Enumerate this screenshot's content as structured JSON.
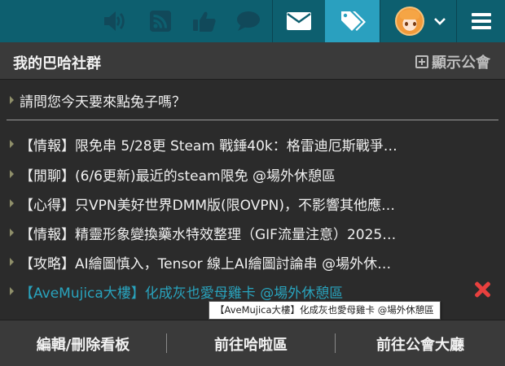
{
  "navbar": {
    "icons": [
      "volume-icon",
      "rss-icon",
      "thumbs-up-icon",
      "chat-bubble-icon",
      "envelope-icon",
      "tags-icon",
      "avatar",
      "chevron-down-icon",
      "menu-icon"
    ],
    "active_color": "#2aa0bf",
    "bar_color": "#0d5f6f"
  },
  "panel": {
    "title": "我的巴哈社群",
    "show_guild_label": "顯示公會",
    "prompt": "請問您今天要來點兔子嗎？",
    "items": [
      {
        "label": "【情報】限免串 5/28更 Steam 戰錘40k：格雷迪厄斯戰爭…"
      },
      {
        "label": "【閒聊】(6/6更新)最近的steam限免 @場外休憩區"
      },
      {
        "label": "【心得】只VPN美好世界DMM版(限OVPN)，不影響其他應…"
      },
      {
        "label": "【情報】精靈形象變換藥水特效整理（GIF流量注意）2025…"
      },
      {
        "label": "【攻略】AI繪圖慎入，Tensor 線上AI繪圖討論串 @場外休…"
      },
      {
        "label": "【AveMujica大樓】化成灰也愛母雞卡 @場外休憩區"
      }
    ],
    "highlight_color": "#29a3bd",
    "tooltip": "【AveMujica大樓】化成灰也愛母雞卡 @場外休憩區"
  },
  "footer": {
    "edit_label": "編輯/刪除看板",
    "goto_hala_label": "前往哈啦區",
    "goto_guild_label": "前往公會大廳"
  }
}
